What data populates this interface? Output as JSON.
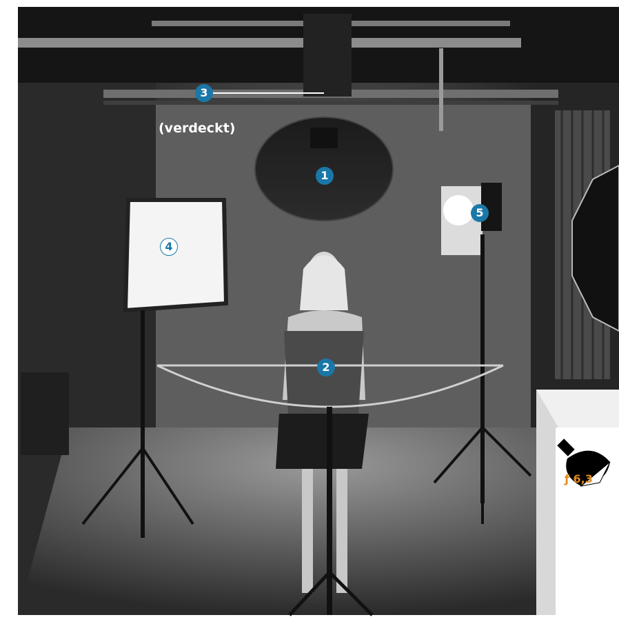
{
  "markers": [
    {
      "label": "1"
    },
    {
      "label": "2"
    },
    {
      "label": "3"
    },
    {
      "label": "4"
    },
    {
      "label": "5"
    }
  ],
  "note": "(verdeckt)",
  "exposure": "ƒ 6,3",
  "colors": {
    "marker": "#1a78a8",
    "exposure_text": "#e08a1e",
    "background": "#1a1a1a"
  }
}
